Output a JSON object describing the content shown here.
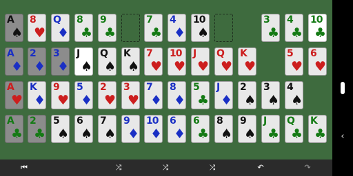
{
  "colors": {
    "felt": "#3e6b3e",
    "toolbar": "#2b2b2b",
    "red": "#cc1e1e",
    "black": "#111111",
    "blue": "#1a2fc4",
    "green": "#147a14"
  },
  "top_row": [
    {
      "rank": "A",
      "suit": "♠",
      "color": "blk",
      "style": "gray"
    },
    {
      "rank": "8",
      "suit": "♥",
      "color": "red",
      "style": "normal"
    },
    {
      "rank": "Q",
      "suit": "♦",
      "color": "blu",
      "style": "normal"
    },
    {
      "rank": "8",
      "suit": "♣",
      "color": "grn",
      "style": "normal"
    },
    {
      "rank": "9",
      "suit": "♣",
      "color": "grn",
      "style": "normal"
    },
    {
      "empty": true
    },
    {
      "rank": "7",
      "suit": "♣",
      "color": "grn",
      "style": "normal"
    },
    {
      "rank": "4",
      "suit": "♦",
      "color": "blu",
      "style": "normal"
    },
    {
      "rank": "10",
      "suit": "♠",
      "color": "blk",
      "style": "normal"
    },
    {
      "empty": true
    },
    {
      "rank": "3",
      "suit": "♣",
      "color": "grn",
      "style": "normal"
    },
    {
      "rank": "4",
      "suit": "♣",
      "color": "grn",
      "style": "normal"
    },
    {
      "rank": "10",
      "suit": "♣",
      "color": "grn",
      "style": "white"
    }
  ],
  "row2": [
    {
      "rank": "A",
      "suit": "♦",
      "color": "blu",
      "style": "gray"
    },
    {
      "rank": "2",
      "suit": "♦",
      "color": "blu",
      "style": "gray"
    },
    {
      "rank": "3",
      "suit": "♦",
      "color": "blu",
      "style": "gray"
    },
    {
      "rank": "J",
      "suit": "♠",
      "color": "blk",
      "style": "white"
    },
    {
      "rank": "Q",
      "suit": "♠",
      "color": "blk",
      "style": "normal"
    },
    {
      "rank": "K",
      "suit": "♠",
      "color": "blk",
      "style": "normal"
    },
    {
      "rank": "7",
      "suit": "♥",
      "color": "red",
      "style": "normal"
    },
    {
      "rank": "10",
      "suit": "♥",
      "color": "red",
      "style": "normal"
    },
    {
      "rank": "J",
      "suit": "♥",
      "color": "red",
      "style": "normal"
    },
    {
      "rank": "Q",
      "suit": "♥",
      "color": "red",
      "style": "normal"
    },
    {
      "rank": "K",
      "suit": "♥",
      "color": "red",
      "style": "normal"
    },
    {
      "rank": "5",
      "suit": "♥",
      "color": "red",
      "style": "normal"
    },
    {
      "rank": "6",
      "suit": "♥",
      "color": "red",
      "style": "normal"
    }
  ],
  "row3": [
    {
      "rank": "A",
      "suit": "♥",
      "color": "red",
      "style": "gray"
    },
    {
      "rank": "K",
      "suit": "♦",
      "color": "blu",
      "style": "normal"
    },
    {
      "rank": "9",
      "suit": "♥",
      "color": "red",
      "style": "normal"
    },
    {
      "rank": "5",
      "suit": "♦",
      "color": "blu",
      "style": "normal"
    },
    {
      "rank": "2",
      "suit": "♥",
      "color": "red",
      "style": "normal"
    },
    {
      "rank": "3",
      "suit": "♥",
      "color": "red",
      "style": "normal"
    },
    {
      "rank": "7",
      "suit": "♦",
      "color": "blu",
      "style": "normal"
    },
    {
      "rank": "8",
      "suit": "♦",
      "color": "blu",
      "style": "normal"
    },
    {
      "rank": "5",
      "suit": "♣",
      "color": "grn",
      "style": "normal"
    },
    {
      "rank": "J",
      "suit": "♦",
      "color": "blu",
      "style": "normal"
    },
    {
      "rank": "2",
      "suit": "♠",
      "color": "blk",
      "style": "normal"
    },
    {
      "rank": "3",
      "suit": "♠",
      "color": "blk",
      "style": "normal"
    },
    {
      "rank": "4",
      "suit": "♠",
      "color": "blk",
      "style": "normal"
    }
  ],
  "row4": [
    {
      "rank": "A",
      "suit": "♣",
      "color": "grn",
      "style": "gray"
    },
    {
      "rank": "2",
      "suit": "♣",
      "color": "grn",
      "style": "gray"
    },
    {
      "rank": "5",
      "suit": "♠",
      "color": "blk",
      "style": "normal"
    },
    {
      "rank": "6",
      "suit": "♠",
      "color": "blk",
      "style": "normal"
    },
    {
      "rank": "7",
      "suit": "♠",
      "color": "blk",
      "style": "normal"
    },
    {
      "rank": "9",
      "suit": "♦",
      "color": "blu",
      "style": "normal"
    },
    {
      "rank": "10",
      "suit": "♦",
      "color": "blu",
      "style": "normal"
    },
    {
      "rank": "6",
      "suit": "♦",
      "color": "blu",
      "style": "normal"
    },
    {
      "rank": "6",
      "suit": "♣",
      "color": "grn",
      "style": "normal"
    },
    {
      "rank": "8",
      "suit": "♠",
      "color": "blk",
      "style": "normal"
    },
    {
      "rank": "9",
      "suit": "♠",
      "color": "blk",
      "style": "normal"
    },
    {
      "rank": "J",
      "suit": "♣",
      "color": "grn",
      "style": "normal"
    },
    {
      "rank": "Q",
      "suit": "♣",
      "color": "grn",
      "style": "normal"
    },
    {
      "rank": "K",
      "suit": "♣",
      "color": "grn",
      "style": "normal"
    }
  ],
  "toolbar": {
    "first_icon": "⏮",
    "shuffle_icon": "⤨",
    "undo_icon": "↶",
    "redo_icon": "↷"
  },
  "sidebar": {
    "back_icon": "‹"
  }
}
